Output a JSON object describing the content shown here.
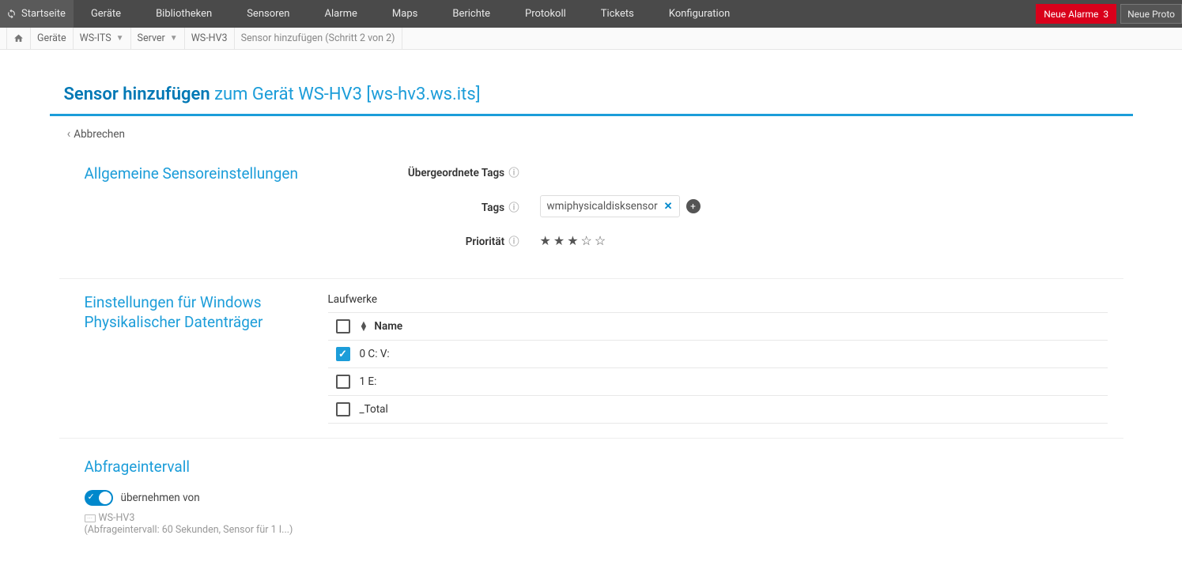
{
  "topnav": {
    "items": [
      "Startseite",
      "Geräte",
      "Bibliotheken",
      "Sensoren",
      "Alarme",
      "Maps",
      "Berichte",
      "Protokoll",
      "Tickets",
      "Konfiguration"
    ],
    "alarm_label": "Neue Alarme",
    "alarm_count": "3",
    "proto_label": "Neue Proto"
  },
  "breadcrumb": {
    "items": [
      {
        "label": "",
        "icon": "home",
        "dropdown": false
      },
      {
        "label": "Geräte",
        "dropdown": false
      },
      {
        "label": "WS-ITS",
        "dropdown": true
      },
      {
        "label": "Server",
        "dropdown": true
      },
      {
        "label": "WS-HV3",
        "dropdown": false
      },
      {
        "label": "Sensor hinzufügen (Schritt 2 von 2)",
        "dropdown": false,
        "nolink": true
      }
    ]
  },
  "header": {
    "bold": "Sensor hinzufügen",
    "rest": "zum Gerät WS-HV3 [ws-hv3.ws.its]"
  },
  "cancel": "Abbrechen",
  "section_general": {
    "title": "Allgemeine Sensoreinstellungen",
    "parent_tags_label": "Übergeordnete Tags",
    "tags_label": "Tags",
    "tag_value": "wmiphysicaldisksensor",
    "priority_label": "Priorität",
    "priority_value": 3,
    "priority_max": 5
  },
  "section_disk": {
    "title": "Einstellungen für Windows Physikalischer Datenträger",
    "drives_label": "Laufwerke",
    "header_name": "Name",
    "rows": [
      {
        "name": "0 C: V:",
        "checked": true
      },
      {
        "name": "1 E:",
        "checked": false
      },
      {
        "name": "_Total",
        "checked": false
      }
    ]
  },
  "section_interval": {
    "title": "Abfrageintervall",
    "inherit_label": "übernehmen von",
    "device": "WS-HV3",
    "detail": "(Abfrageintervall: 60 Sekunden, Sensor für 1 I...)"
  }
}
